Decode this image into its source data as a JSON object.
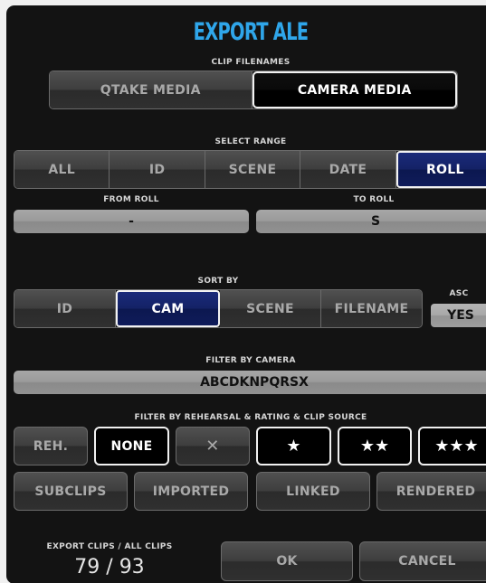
{
  "dialog": {
    "title": "EXPORT ALE"
  },
  "clip_filenames": {
    "label": "CLIP FILENAMES",
    "options": [
      "QTAKE MEDIA",
      "CAMERA MEDIA"
    ],
    "selected": "CAMERA MEDIA"
  },
  "select_range": {
    "label": "SELECT RANGE",
    "options": [
      "ALL",
      "ID",
      "SCENE",
      "DATE",
      "ROLL"
    ],
    "selected": "ROLL",
    "from_label": "FROM ROLL",
    "from_value": "-",
    "to_label": "TO ROLL",
    "to_value": "S"
  },
  "sort_by": {
    "label": "SORT BY",
    "options": [
      "ID",
      "CAM",
      "SCENE",
      "FILENAME"
    ],
    "selected": "CAM",
    "order_label": "ASC",
    "order_value": "YES"
  },
  "filter_camera": {
    "label": "FILTER BY CAMERA",
    "value": "ABCDKNPQRSX"
  },
  "filter_rating": {
    "label": "FILTER BY REHEARSAL & RATING & CLIP SOURCE",
    "rehearsal": "REH.",
    "none": "NONE",
    "reject": "✕",
    "one_star": "★",
    "two_star": "★★",
    "three_star": "★★★",
    "sources": [
      "SUBCLIPS",
      "IMPORTED",
      "LINKED",
      "RENDERED"
    ]
  },
  "footer": {
    "count_label": "EXPORT CLIPS / ALL CLIPS",
    "count_value": "79 / 93",
    "ok": "OK",
    "cancel": "CANCEL"
  },
  "colors": {
    "title_blue": "#2fa6ea",
    "navy_active": "#142266",
    "panel_bg": "#131313"
  }
}
